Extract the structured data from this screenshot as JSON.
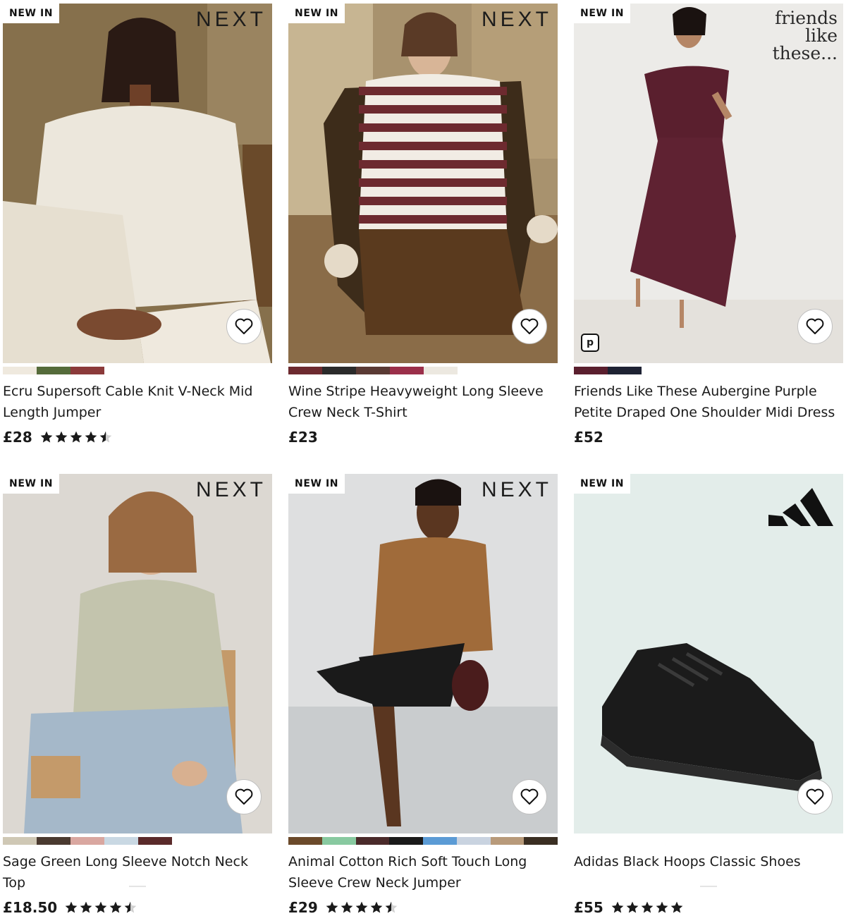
{
  "products": [
    {
      "badge": "NEW IN",
      "brand": "NEXT",
      "title": "Ecru Supersoft Cable Knit V-Neck Mid Length Jumper",
      "price": "£28",
      "rating": 4.5,
      "swatches": [
        "#efe9de",
        "#556b3a",
        "#8b3a3a"
      ]
    },
    {
      "badge": "NEW IN",
      "brand": "NEXT",
      "title": "Wine Stripe Heavyweight Long Sleeve Crew Neck T-Shirt",
      "price": "£23",
      "rating": null,
      "swatches": [
        "#6d2a2f",
        "#2b2b2b",
        "#5a3a34",
        "#9b2f4a",
        "#ece8e0"
      ]
    },
    {
      "badge": "NEW IN",
      "brand": "friends like these...",
      "title": "Friends Like These Aubergine Purple Petite Draped One Shoulder Midi Dress",
      "price": "£52",
      "rating": null,
      "swatches": [
        "#5a1f2e",
        "#1e2233"
      ]
    },
    {
      "badge": "NEW IN",
      "brand": "NEXT",
      "title": "Sage Green Long Sleeve Notch Neck Top",
      "price": "£18.50",
      "rating": 4.5,
      "swatches": [
        "#cfc8b5",
        "#4a3a30",
        "#d9a7a0",
        "#c9d8e3",
        "#5a2a2a"
      ]
    },
    {
      "badge": "NEW IN",
      "brand": "NEXT",
      "title": "Animal Cotton Rich Soft Touch Long Sleeve Crew Neck Jumper",
      "price": "£29",
      "rating": 4.5,
      "swatches": [
        "#6b4a2a",
        "#88c9a0",
        "#4a2a2a",
        "#1a1a1a",
        "#5b9bd5",
        "#c9d3e0",
        "#b89a7a",
        "#3a2e22"
      ]
    },
    {
      "badge": "NEW IN",
      "brand": "adidas-logo",
      "title": "Adidas Black Hoops Classic Shoes",
      "price": "£55",
      "rating": 5,
      "swatches": []
    }
  ],
  "icons": {
    "favourite": "heart-outline-icon",
    "pinterest": "pinterest-icon",
    "rating": "star-icon"
  },
  "colors": {
    "text": "#1a1a1a",
    "star": "#1a1a1a",
    "badge_bg": "#ffffff"
  }
}
